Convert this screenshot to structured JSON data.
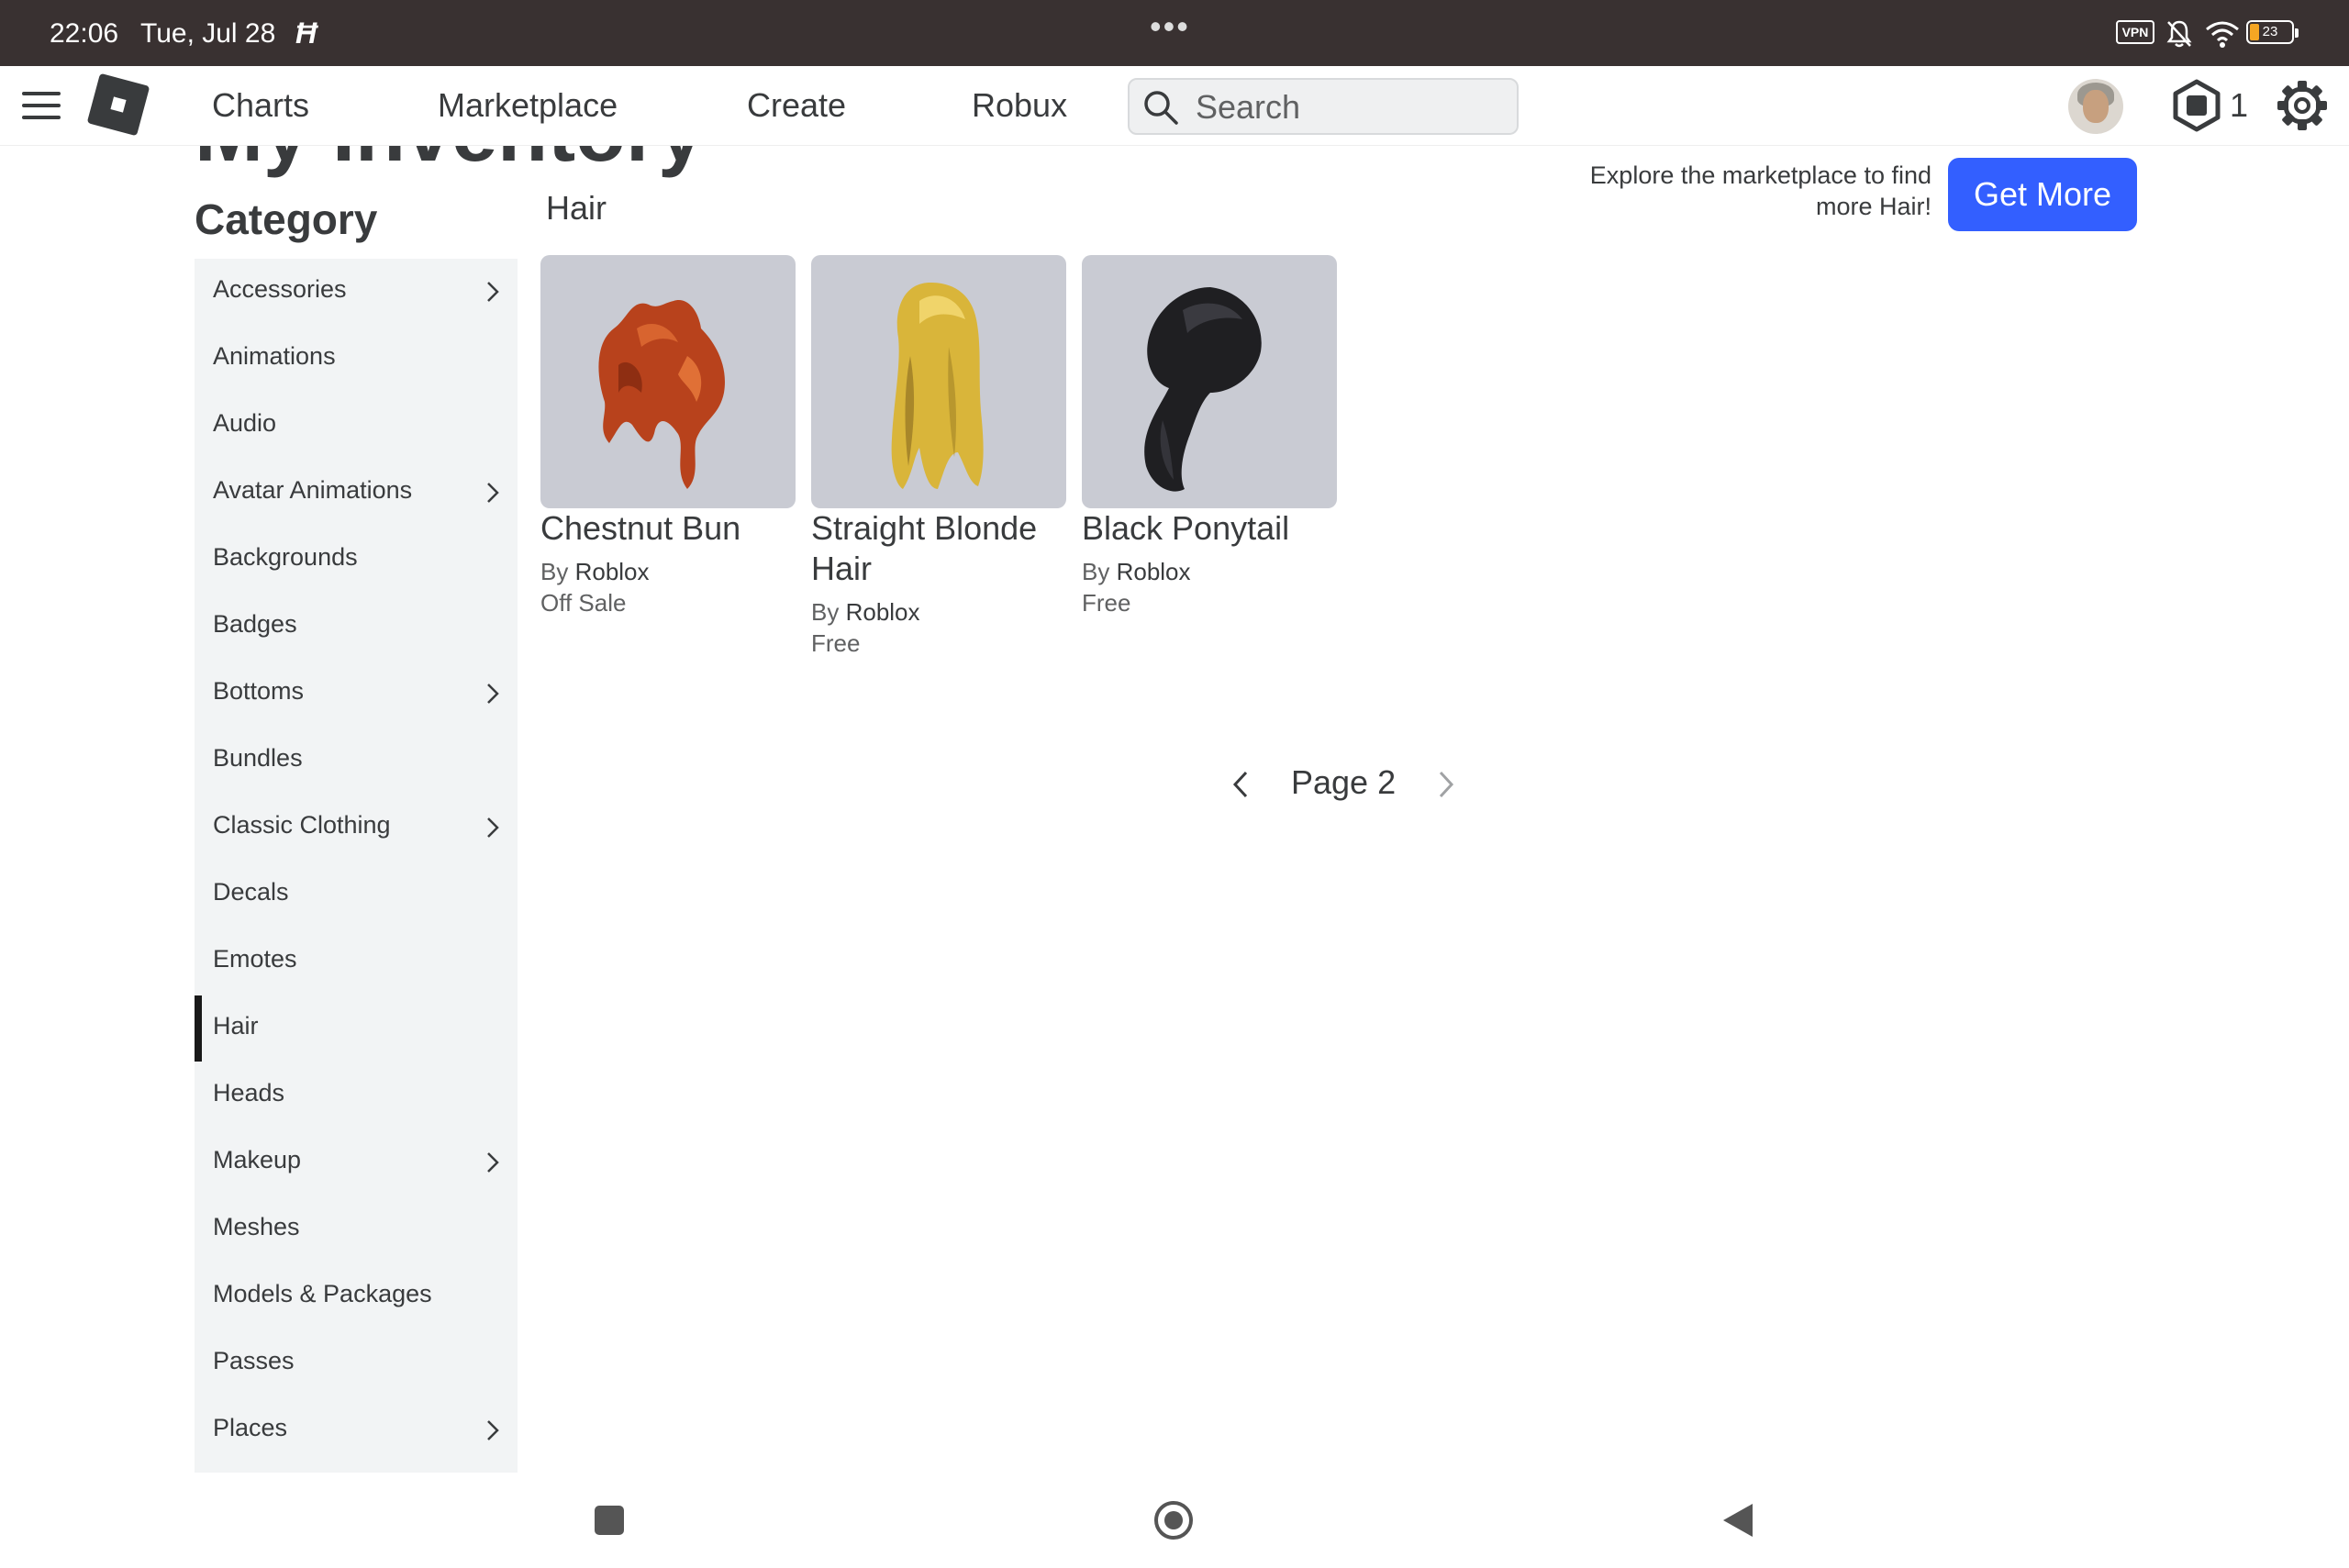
{
  "status_bar": {
    "time": "22:06",
    "date": "Tue, Jul 28",
    "vpn": "VPN",
    "battery": "23"
  },
  "topnav": {
    "links": [
      "Charts",
      "Marketplace",
      "Create",
      "Robux"
    ],
    "search_placeholder": "Search",
    "robux_balance": "1"
  },
  "page": {
    "title": "My Inventory"
  },
  "sidebar": {
    "heading": "Category",
    "items": [
      {
        "label": "Accessories",
        "has_submenu": true
      },
      {
        "label": "Animations",
        "has_submenu": false
      },
      {
        "label": "Audio",
        "has_submenu": false
      },
      {
        "label": "Avatar Animations",
        "has_submenu": true
      },
      {
        "label": "Backgrounds",
        "has_submenu": false
      },
      {
        "label": "Badges",
        "has_submenu": false
      },
      {
        "label": "Bottoms",
        "has_submenu": true
      },
      {
        "label": "Bundles",
        "has_submenu": false
      },
      {
        "label": "Classic Clothing",
        "has_submenu": true
      },
      {
        "label": "Decals",
        "has_submenu": false
      },
      {
        "label": "Emotes",
        "has_submenu": false
      },
      {
        "label": "Hair",
        "has_submenu": false,
        "active": true
      },
      {
        "label": "Heads",
        "has_submenu": false
      },
      {
        "label": "Makeup",
        "has_submenu": true
      },
      {
        "label": "Meshes",
        "has_submenu": false
      },
      {
        "label": "Models & Packages",
        "has_submenu": false
      },
      {
        "label": "Passes",
        "has_submenu": false
      },
      {
        "label": "Places",
        "has_submenu": true
      }
    ]
  },
  "content": {
    "section_title": "Hair",
    "promo_text": "Explore the marketplace to find more Hair!",
    "get_more_label": "Get More",
    "items": [
      {
        "name": "Chestnut Bun",
        "by": "By",
        "creator": "Roblox",
        "price": "Off Sale",
        "color": "#b8421c"
      },
      {
        "name": "Straight Blonde Hair",
        "by": "By",
        "creator": "Roblox",
        "price": "Free",
        "color": "#d9b53a"
      },
      {
        "name": "Black Ponytail",
        "by": "By",
        "creator": "Roblox",
        "price": "Free",
        "color": "#1f1f22"
      }
    ],
    "pager_label": "Page 2"
  },
  "colors": {
    "accent": "#335fff",
    "status_bar": "#393131",
    "text": "#393b3d",
    "sidebar_bg": "#f2f4f5"
  }
}
